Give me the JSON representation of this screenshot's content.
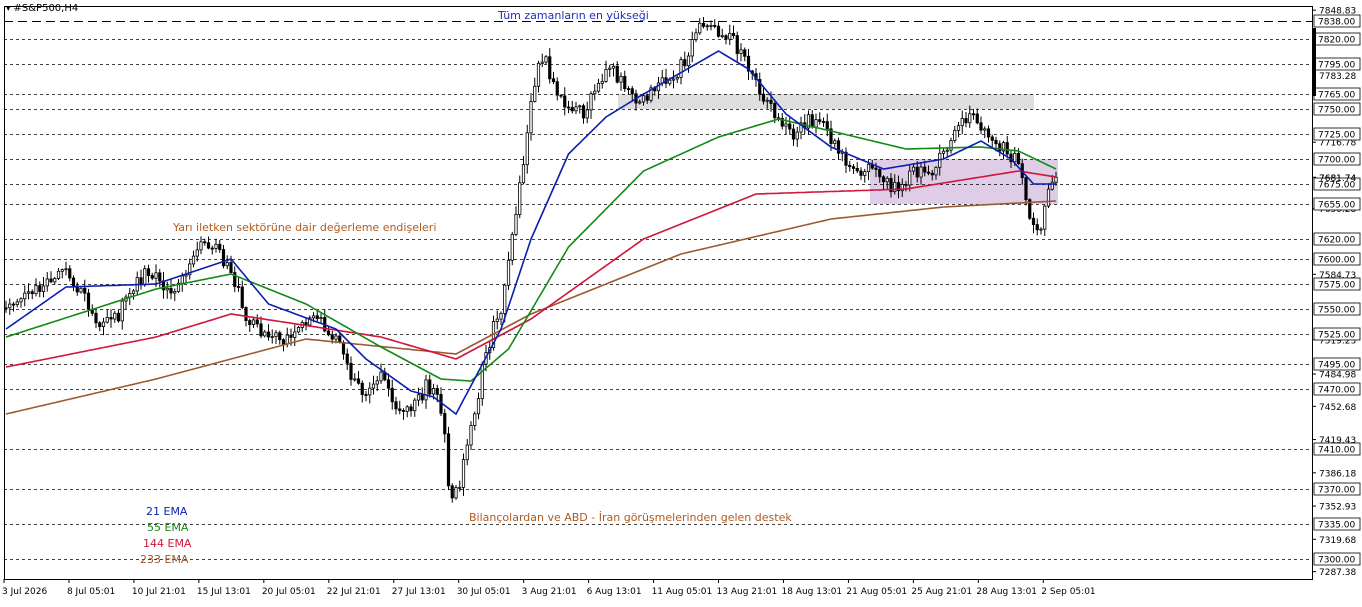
{
  "header": {
    "symbol_label": "#S&P500,H4"
  },
  "annotations": {
    "ath": "Tüm zamanların en yükseği",
    "semis": "Yarı iletken sektörüne dair değerleme endişeleri",
    "support": "Bilançolardan ve ABD - İran görüşmelerinden gelen destek"
  },
  "colors": {
    "ema21": "#0a1fb0",
    "ema55": "#138a13",
    "ema144": "#d0163c",
    "ema233": "#9a5a32",
    "candle": "#000000",
    "zone_top": "#d8d8d8",
    "zone_mid": "#dcc8e6",
    "ath_text": "#1f2fb8",
    "note_text": "#b05a1e"
  },
  "chart_data": {
    "type": "candlestick",
    "title": "#S&P500,H4",
    "timeframe": "H4",
    "grid": false,
    "ylim": [
      7280,
      7853
    ],
    "x_tick_labels": [
      "3 Jul 2026",
      "8 Jul 05:01",
      "10 Jul 21:01",
      "15 Jul 13:01",
      "20 Jul 05:01",
      "22 Jul 21:01",
      "27 Jul 13:01",
      "30 Jul 05:01",
      "3 Aug 21:01",
      "6 Aug 13:01",
      "11 Aug 05:01",
      "13 Aug 21:01",
      "18 Aug 13:01",
      "21 Aug 05:01",
      "25 Aug 21:01",
      "28 Aug 13:01",
      "2 Sep 05:01"
    ],
    "y_tick_labels": [
      "7848.83",
      "7783.28",
      "7716.78",
      "7681.74",
      "7650.28",
      "7584.73",
      "7519.23",
      "7484.98",
      "7452.68",
      "7419.43",
      "7386.18",
      "7352.93",
      "7319.68",
      "7287.38"
    ],
    "y_ticks": [
      7848.83,
      7783.28,
      7716.78,
      7681.74,
      7650.28,
      7584.73,
      7519.23,
      7484.98,
      7452.68,
      7419.43,
      7386.18,
      7352.93,
      7319.68,
      7287.38
    ],
    "level_labels": [
      "7838.00",
      "7820.00",
      "7795.00",
      "7765.00",
      "7750.00",
      "7725.00",
      "7700.00",
      "7675.00",
      "7655.00",
      "7620.00",
      "7600.00",
      "7575.00",
      "7550.00",
      "7525.00",
      "7495.00",
      "7470.00",
      "7410.00",
      "7370.00",
      "7335.00",
      "7300.00"
    ],
    "levels": [
      7838,
      7820,
      7795,
      7765,
      7750,
      7725,
      7700,
      7675,
      7655,
      7620,
      7600,
      7575,
      7550,
      7525,
      7495,
      7470,
      7410,
      7370,
      7335,
      7300
    ],
    "current_price_label": "7681.74",
    "zones": [
      {
        "name": "upper-resistance-zone",
        "from": 7750,
        "to": 7765
      },
      {
        "name": "consolidation-zone",
        "from": 7655,
        "to": 7700
      }
    ],
    "price_anchors": [
      [
        0,
        7548
      ],
      [
        5,
        7560
      ],
      [
        10,
        7575
      ],
      [
        16,
        7592
      ],
      [
        20,
        7568
      ],
      [
        25,
        7535
      ],
      [
        30,
        7545
      ],
      [
        34,
        7572
      ],
      [
        38,
        7590
      ],
      [
        44,
        7560
      ],
      [
        48,
        7590
      ],
      [
        52,
        7612
      ],
      [
        56,
        7610
      ],
      [
        60,
        7590
      ],
      [
        64,
        7545
      ],
      [
        68,
        7528
      ],
      [
        72,
        7520
      ],
      [
        76,
        7520
      ],
      [
        80,
        7540
      ],
      [
        84,
        7538
      ],
      [
        88,
        7522
      ],
      [
        92,
        7478
      ],
      [
        96,
        7468
      ],
      [
        100,
        7488
      ],
      [
        104,
        7455
      ],
      [
        108,
        7448
      ],
      [
        112,
        7470
      ],
      [
        116,
        7455
      ],
      [
        118,
        7380
      ],
      [
        120,
        7362
      ],
      [
        122,
        7398
      ],
      [
        126,
        7470
      ],
      [
        128,
        7505
      ],
      [
        132,
        7555
      ],
      [
        134,
        7600
      ],
      [
        136,
        7650
      ],
      [
        138,
        7700
      ],
      [
        140,
        7765
      ],
      [
        144,
        7808
      ],
      [
        146,
        7770
      ],
      [
        150,
        7750
      ],
      [
        154,
        7745
      ],
      [
        158,
        7778
      ],
      [
        162,
        7790
      ],
      [
        166,
        7765
      ],
      [
        170,
        7758
      ],
      [
        174,
        7780
      ],
      [
        178,
        7782
      ],
      [
        182,
        7805
      ],
      [
        186,
        7838
      ],
      [
        190,
        7828
      ],
      [
        194,
        7818
      ],
      [
        198,
        7790
      ],
      [
        202,
        7762
      ],
      [
        206,
        7738
      ],
      [
        210,
        7720
      ],
      [
        214,
        7740
      ],
      [
        218,
        7735
      ],
      [
        222,
        7705
      ],
      [
        226,
        7685
      ],
      [
        230,
        7695
      ],
      [
        234,
        7678
      ],
      [
        238,
        7670
      ],
      [
        242,
        7690
      ],
      [
        246,
        7685
      ],
      [
        250,
        7705
      ],
      [
        254,
        7740
      ],
      [
        258,
        7742
      ],
      [
        262,
        7722
      ],
      [
        266,
        7710
      ],
      [
        270,
        7698
      ],
      [
        272,
        7660
      ],
      [
        274,
        7635
      ],
      [
        276,
        7628
      ],
      [
        278,
        7675
      ],
      [
        280,
        7681.74
      ]
    ],
    "series": [
      {
        "name": "21 EMA",
        "period": 21,
        "color": "#0a1fb0"
      },
      {
        "name": "55 EMA",
        "period": 55,
        "color": "#138a13"
      },
      {
        "name": "144 EMA",
        "period": 144,
        "color": "#d0163c"
      },
      {
        "name": "233 EMA",
        "period": 233,
        "color": "#9a5a32"
      }
    ],
    "ema233_anchors": [
      [
        0,
        7445
      ],
      [
        40,
        7480
      ],
      [
        80,
        7520
      ],
      [
        120,
        7505
      ],
      [
        140,
        7545
      ],
      [
        180,
        7605
      ],
      [
        220,
        7640
      ],
      [
        250,
        7652
      ],
      [
        280,
        7658
      ]
    ],
    "ema144_anchors": [
      [
        0,
        7492
      ],
      [
        40,
        7522
      ],
      [
        60,
        7545
      ],
      [
        100,
        7522
      ],
      [
        120,
        7500
      ],
      [
        140,
        7540
      ],
      [
        170,
        7620
      ],
      [
        200,
        7665
      ],
      [
        240,
        7670
      ],
      [
        270,
        7688
      ],
      [
        280,
        7682
      ]
    ],
    "ema55_anchors": [
      [
        0,
        7522
      ],
      [
        40,
        7570
      ],
      [
        60,
        7585
      ],
      [
        80,
        7555
      ],
      [
        100,
        7512
      ],
      [
        116,
        7480
      ],
      [
        124,
        7478
      ],
      [
        134,
        7510
      ],
      [
        150,
        7612
      ],
      [
        170,
        7688
      ],
      [
        190,
        7722
      ],
      [
        206,
        7740
      ],
      [
        220,
        7728
      ],
      [
        240,
        7710
      ],
      [
        260,
        7712
      ],
      [
        270,
        7708
      ],
      [
        280,
        7690
      ]
    ],
    "ema21_anchors": [
      [
        0,
        7530
      ],
      [
        16,
        7572
      ],
      [
        40,
        7575
      ],
      [
        60,
        7600
      ],
      [
        70,
        7555
      ],
      [
        88,
        7530
      ],
      [
        96,
        7500
      ],
      [
        108,
        7468
      ],
      [
        114,
        7462
      ],
      [
        120,
        7445
      ],
      [
        132,
        7530
      ],
      [
        140,
        7620
      ],
      [
        150,
        7705
      ],
      [
        160,
        7742
      ],
      [
        170,
        7765
      ],
      [
        184,
        7795
      ],
      [
        190,
        7808
      ],
      [
        198,
        7790
      ],
      [
        208,
        7745
      ],
      [
        220,
        7712
      ],
      [
        234,
        7690
      ],
      [
        250,
        7700
      ],
      [
        260,
        7718
      ],
      [
        268,
        7700
      ],
      [
        274,
        7675
      ],
      [
        280,
        7675
      ]
    ]
  },
  "legend": {
    "ema21": "21 EMA",
    "ema55": "55 EMA",
    "ema144": "144 EMA",
    "ema233": "233 EMA"
  }
}
